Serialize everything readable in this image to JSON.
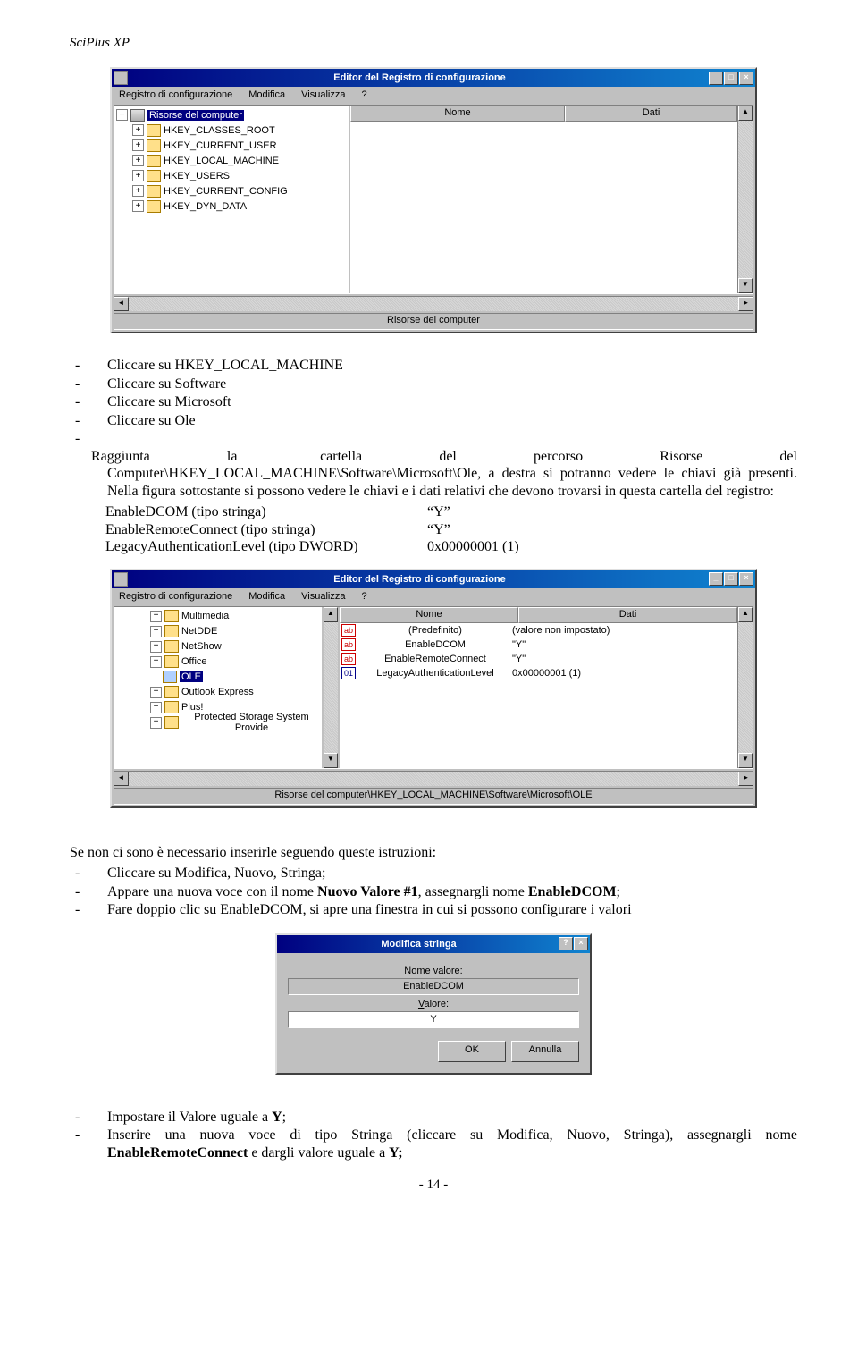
{
  "header": {
    "title": "SciPlus XP"
  },
  "regedit1": {
    "title": "Editor del Registro di configurazione",
    "menu": [
      "Registro di configurazione",
      "Modifica",
      "Visualizza",
      "?"
    ],
    "cols": {
      "name": "Nome",
      "data": "Dati"
    },
    "root": "Risorse del computer",
    "tree": [
      "HKEY_CLASSES_ROOT",
      "HKEY_CURRENT_USER",
      "HKEY_LOCAL_MACHINE",
      "HKEY_USERS",
      "HKEY_CURRENT_CONFIG",
      "HKEY_DYN_DATA"
    ],
    "status": "Risorse del computer"
  },
  "para1": {
    "li1": "Cliccare su HKEY_LOCAL_MACHINE",
    "li2": "Cliccare su Software",
    "li3": "Cliccare su Microsoft",
    "li4": "Cliccare su Ole",
    "li5a": "Raggiunta",
    "li5b": "la",
    "li5c": "cartella",
    "li5d": "del",
    "li5e": "percorso",
    "li5f": "Risorse",
    "li5g": "del",
    "li5cont": "Computer\\HKEY_LOCAL_MACHINE\\Software\\Microsoft\\Ole, a destra si potranno vedere le chiavi già presenti. Nella figura sottostante si possono vedere le chiavi e i dati relativi che devono trovarsi in questa cartella del registro:",
    "kv1k": "EnableDCOM   (tipo stringa)",
    "kv1v": "“Y”",
    "kv2k": "EnableRemoteConnect (tipo stringa)",
    "kv2v": "“Y”",
    "kv3k": "LegacyAuthenticationLevel (tipo DWORD)",
    "kv3v": "0x00000001 (1)"
  },
  "regedit2": {
    "title": "Editor del Registro di configurazione",
    "menu": [
      "Registro di configurazione",
      "Modifica",
      "Visualizza",
      "?"
    ],
    "cols": {
      "name": "Nome",
      "data": "Dati"
    },
    "tree": [
      "Multimedia",
      "NetDDE",
      "NetShow",
      "Office",
      "OLE",
      "Outlook Express",
      "Plus!",
      "Protected Storage System Provide"
    ],
    "rows": [
      {
        "icon": "ab",
        "name": "(Predefinito)",
        "data": "(valore non impostato)"
      },
      {
        "icon": "ab",
        "name": "EnableDCOM",
        "data": "\"Y\""
      },
      {
        "icon": "ab",
        "name": "EnableRemoteConnect",
        "data": "\"Y\""
      },
      {
        "icon": "dw",
        "name": "LegacyAuthenticationLevel",
        "data": "0x00000001 (1)"
      }
    ],
    "status": "Risorse del computer\\HKEY_LOCAL_MACHINE\\Software\\Microsoft\\OLE"
  },
  "para2": {
    "intro": "Se non ci sono è necessario inserirle seguendo queste istruzioni:",
    "li1": "Cliccare su Modifica, Nuovo, Stringa;",
    "li2a": "Appare una nuova voce con il nome ",
    "li2b": "Nuovo Valore #1",
    "li2c": ", assegnargli nome ",
    "li2d": "EnableDCOM",
    "li2e": ";",
    "li3": "Fare doppio clic su EnableDCOM, si apre una finestra in cui si possono configurare i valori"
  },
  "dialog": {
    "title": "Modifica stringa",
    "label1": "Nome valore:",
    "val1": "EnableDCOM",
    "label2": "Valore:",
    "val2": "Y",
    "ok": "OK",
    "cancel": "Annulla"
  },
  "para3": {
    "li1a": "Impostare il Valore uguale a ",
    "li1b": "Y",
    "li1c": ";",
    "li2a": "Inserire una nuova voce di tipo Stringa (cliccare su Modifica, Nuovo, Stringa), assegnargli nome ",
    "li2b": "EnableRemoteConnect",
    "li2c": " e dargli valore uguale a ",
    "li2d": "Y;"
  },
  "footer": {
    "page": "- 14 -"
  }
}
